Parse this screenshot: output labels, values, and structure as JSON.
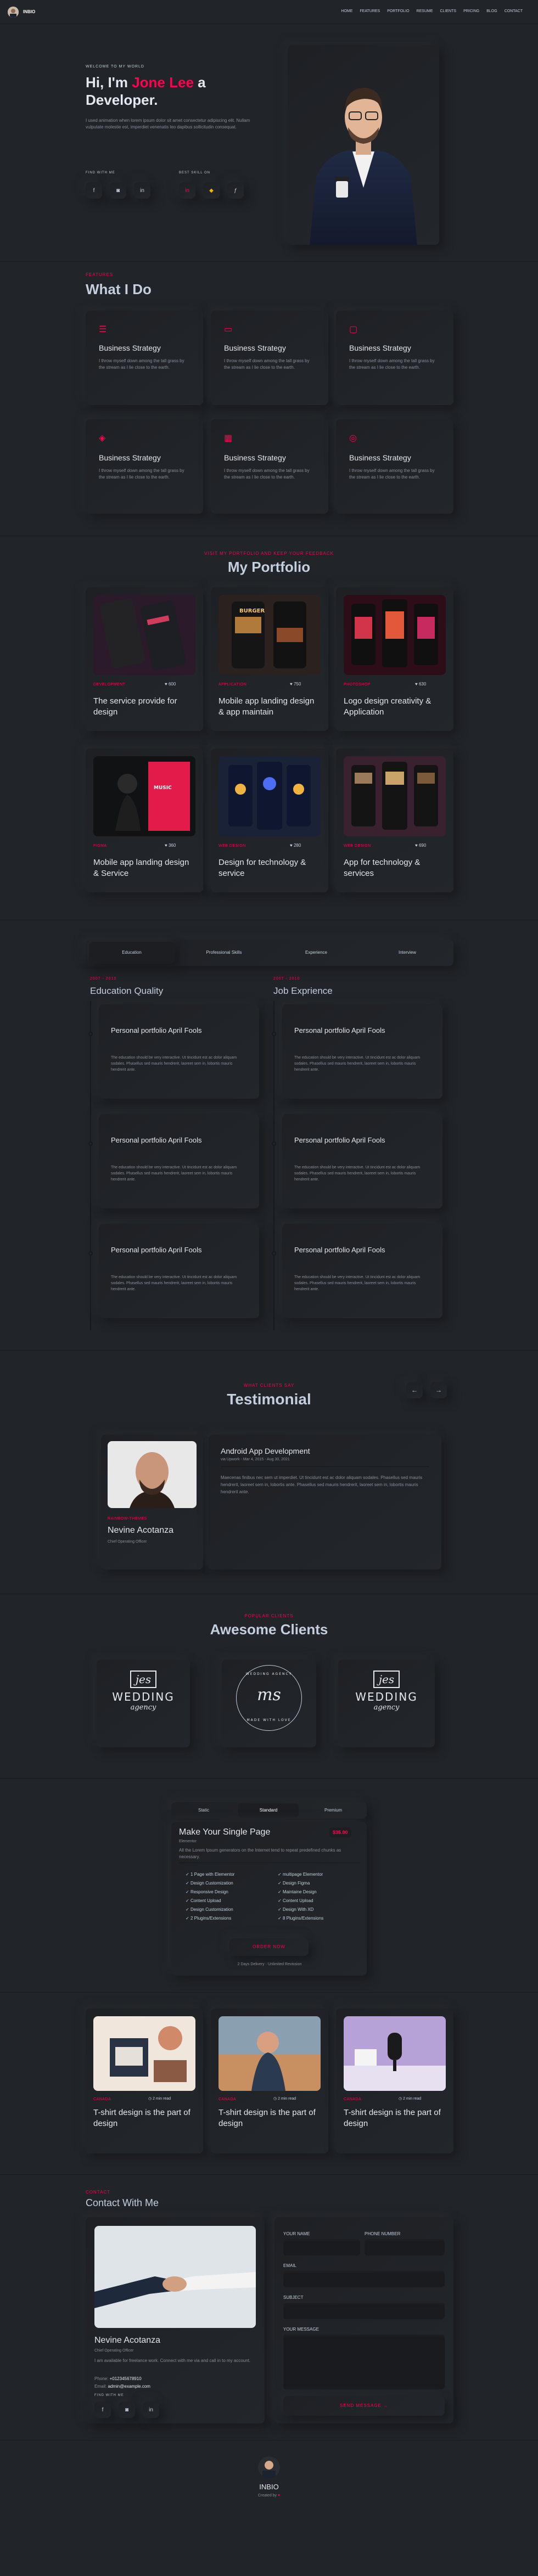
{
  "header": {
    "logo_text": "INBIO",
    "nav": [
      "HOME",
      "FEATURES",
      "PORTFOLIO",
      "RESUME",
      "CLIENTS",
      "PRICING",
      "BLOG",
      "CONTACT"
    ]
  },
  "hero": {
    "welcome": "WELCOME TO MY WORLD",
    "hi": "Hi, I'm ",
    "name": "Jone Lee",
    "a": " a",
    "role": "Developer.",
    "desc": "I used animation when lorem ipsum dolor sit amet consectetur adipiscing elit. Nullam vulputate molestie est, imperdiet venenatis leo dapibus sollicitudin consequat.",
    "find_label": "FIND WITH ME",
    "skills_label": "BEST SKILL ON",
    "social": [
      "facebook-icon",
      "instagram-icon",
      "linkedin-icon"
    ],
    "skills": [
      "linkedin-icon",
      "sketch-icon",
      "figma-icon"
    ]
  },
  "features": {
    "subtitle": "FEATURES",
    "title": "What I Do",
    "items": [
      {
        "icon": "menu-icon",
        "title": "Business Strategy",
        "text": "I throw myself down among the tall grass by the stream as I lie close to the earth."
      },
      {
        "icon": "book-icon",
        "title": "Business Strategy",
        "text": "I throw myself down among the tall grass by the stream as I lie close to the earth."
      },
      {
        "icon": "tv-icon",
        "title": "Business Strategy",
        "text": "I throw myself down among the tall grass by the stream as I lie close to the earth."
      },
      {
        "icon": "layers-icon",
        "title": "Business Strategy",
        "text": "I throw myself down among the tall grass by the stream as I lie close to the earth."
      },
      {
        "icon": "grid-icon",
        "title": "Business Strategy",
        "text": "I throw myself down among the tall grass by the stream as I lie close to the earth."
      },
      {
        "icon": "target-icon",
        "title": "Business Strategy",
        "text": "I throw myself down among the tall grass by the stream as I lie close to the earth."
      }
    ]
  },
  "portfolio": {
    "subtitle": "VISIT MY PORTFOLIO AND KEEP YOUR FEEDBACK",
    "title": "My Portfolio",
    "items": [
      {
        "tag": "DEVELOPMENT",
        "likes": "600",
        "title": "The service provide for design"
      },
      {
        "tag": "APPLICATION",
        "likes": "750",
        "title": "Mobile app landing design & app maintain"
      },
      {
        "tag": "PHOTOSHOP",
        "likes": "630",
        "title": "Logo design creativity & Application"
      },
      {
        "tag": "FIGMA",
        "likes": "360",
        "title": "Mobile app landing design & Service"
      },
      {
        "tag": "WEB DESIGN",
        "likes": "280",
        "title": "Design for technology & service"
      },
      {
        "tag": "WEB DESIGN",
        "likes": "690",
        "title": "App for technology & services"
      }
    ]
  },
  "resume": {
    "tabs": [
      "Education",
      "Professional Skills",
      "Experience",
      "Interview"
    ],
    "edu_years": "2007 - 2010",
    "edu_title": "Education Quality",
    "job_years": "2007 - 2010",
    "job_title": "Job Exprience",
    "item_title": "Personal portfolio April Fools",
    "item_meta": "University of DVI (1997 - 2001)",
    "item_score": "4.30/5",
    "item_text": "The education should be very interactive. Ut tincidunt est ac dolor aliquam sodales. Phasellus sed mauris hendrerit, laoreet sem in, lobortis mauris hendrerit ante."
  },
  "testimonial": {
    "subtitle": "WHAT CLIENTS SAY",
    "title": "Testimonial",
    "company": "RAINBOW-THEMES",
    "name": "Nevine Acotanza",
    "role": "Chief Operating Officer",
    "project": "Android App Development",
    "via": "via Upwork - Mar 4, 2015 - Aug 30, 2021",
    "text": "Maecenas finibus nec sem ut imperdiet. Ut tincidunt est ac dolor aliquam sodales. Phasellus sed mauris hendrerit, laoreet sem in, lobortis ante. Phasellus sed mauris hendrerit, laoreet sem in, lobortis mauris hendrerit ante."
  },
  "clients": {
    "subtitle": "POPULAR CLIENTS",
    "title": "Awesome Clients",
    "logos": [
      {
        "mono": "jes",
        "word": "WEDDING",
        "script": "agency"
      },
      {
        "mono": "ms",
        "word": "WEDDING AGENCY",
        "script": "MADE WITH LOVE"
      },
      {
        "mono": "jes",
        "word": "WEDDING",
        "script": "agency"
      }
    ]
  },
  "pricing": {
    "tabs": [
      "Static",
      "Standard",
      "Premium"
    ],
    "title": "Make Your Single Page",
    "subtitle": "Elementor",
    "price": "$35.00",
    "desc": "All the Lorem Ipsum generators on the Internet tend to repeat predefined chunks as necessary.",
    "left": [
      "1 Page with Elementor",
      "Design Customization",
      "Responsive Design",
      "Content Upload",
      "Design Customization",
      "2 Plugins/Extensions"
    ],
    "right": [
      "multipage Elementor",
      "Design Figma",
      "Maintaine Design",
      "Content Upload",
      "Design With XD",
      "8 Plugins/Extensions"
    ],
    "button": "ORDER NOW",
    "note": "2 Days Delivery",
    "note2": "Unlimited Revission"
  },
  "blog": {
    "items": [
      {
        "tag": "CANADA",
        "time": "2 min read",
        "title": "T-shirt design is the part of design"
      },
      {
        "tag": "CANADA",
        "time": "2 min read",
        "title": "T-shirt design is the part of design"
      },
      {
        "tag": "CANADA",
        "time": "2 min read",
        "title": "T-shirt design is the part of design"
      }
    ]
  },
  "contact": {
    "subtitle": "CONTACT",
    "title": "Contact With Me",
    "name": "Nevine Acotanza",
    "role": "Chief Operating Officer",
    "text": "I am available for freelance work. Connect with me via and call in to my account.",
    "phone_label": "Phone:",
    "phone": "+012345678910",
    "email_label": "Email:",
    "email": "admin@example.com",
    "find": "FIND WITH ME",
    "form": {
      "name": "YOUR NAME",
      "phone": "PHONE NUMBER",
      "email": "EMAIL",
      "subject": "SUBJECT",
      "message": "YOUR MESSAGE",
      "button": "SEND MESSAGE"
    }
  },
  "footer": {
    "logo": "INBIO",
    "credit": "Created by"
  }
}
